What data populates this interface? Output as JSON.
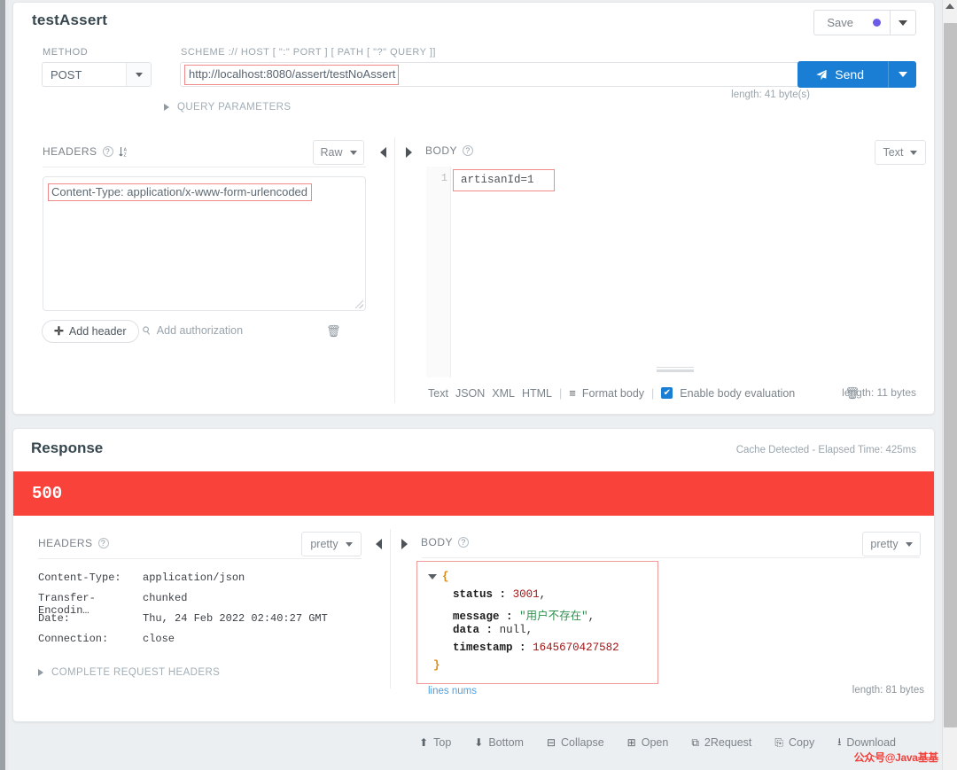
{
  "window": {
    "scrollbar": {
      "up_arrow": "scroll-up-arrow"
    }
  },
  "request": {
    "title": "testAssert",
    "save": {
      "label": "Save",
      "dot_color": "#6c5ce7",
      "caret": "chevron-down-icon"
    },
    "method": {
      "label": "METHOD",
      "value": "POST"
    },
    "url": {
      "label": "SCHEME :// HOST [ \":\" PORT ] [ PATH [ \"?\" QUERY ]]",
      "value": "http://localhost:8080/assert/testNoAssert",
      "length": "length: 41 byte(s)"
    },
    "send": {
      "label": "Send",
      "icon": "paper-plane-icon",
      "color": "#1a7fd4"
    },
    "query_parameters": {
      "label": "QUERY PARAMETERS"
    },
    "headers_panel": {
      "title": "HEADERS",
      "help_icon": "question-circle-icon",
      "sort_icon": "sort-alpha-icon",
      "mode": "Raw",
      "value": "Content-Type: application/x-www-form-urlencoded",
      "add_header": "Add header",
      "add_authorization": "Add authorization",
      "delete_icon": "trash-icon"
    },
    "body_panel": {
      "title": "BODY",
      "help_icon": "question-circle-icon",
      "mode": "Text",
      "line_number": "1",
      "value": "artisanId=1",
      "tabs": [
        "Text",
        "JSON",
        "XML",
        "HTML"
      ],
      "format_body": "Format body",
      "enable_body_evaluation": "Enable body evaluation",
      "enable_checked": true,
      "length": "length: 11 bytes",
      "delete_icon": "trash-icon"
    }
  },
  "response": {
    "title": "Response",
    "meta": "Cache Detected - Elapsed Time: 425ms",
    "status_code": "500",
    "status_color": "#f8423a",
    "headers_panel": {
      "title": "HEADERS",
      "help_icon": "question-circle-icon",
      "mode": "pretty",
      "rows": [
        {
          "key": "Content-Type:",
          "value": "application/json"
        },
        {
          "key": "Transfer-Encodin…",
          "value": "chunked"
        },
        {
          "key": "Date:",
          "value": "Thu, 24 Feb 2022 02:40:27 GMT"
        },
        {
          "key": "Connection:",
          "value": "close"
        }
      ],
      "complete_request_headers": "COMPLETE REQUEST HEADERS"
    },
    "body_panel": {
      "title": "BODY",
      "help_icon": "question-circle-icon",
      "mode": "pretty",
      "json": {
        "open_brace": "{",
        "close_brace": "}",
        "entries": [
          {
            "key": "status",
            "sep": ":",
            "value": "3001",
            "type": "number",
            "comma": ","
          },
          {
            "key": "message",
            "sep": ":",
            "value": "\"用户不存在\"",
            "type": "string",
            "comma": ","
          },
          {
            "key": "data",
            "sep": ":",
            "value": "null",
            "type": "null",
            "comma": ","
          },
          {
            "key": "timestamp",
            "sep": ":",
            "value": "1645670427582",
            "type": "number",
            "comma": ""
          }
        ]
      },
      "lines_nums": "lines nums",
      "length": "length: 81 bytes"
    }
  },
  "bottom_toolbar": [
    {
      "label": "Top",
      "icon": "arrow-up-circle-icon"
    },
    {
      "label": "Bottom",
      "icon": "arrow-down-circle-icon"
    },
    {
      "label": "Collapse",
      "icon": "minus-square-icon"
    },
    {
      "label": "Open",
      "icon": "plus-square-icon"
    },
    {
      "label": "2Request",
      "icon": "copy-request-icon"
    },
    {
      "label": "Copy",
      "icon": "copy-icon"
    },
    {
      "label": "Download",
      "icon": "download-icon"
    }
  ],
  "watermark": "公众号@Java基基"
}
